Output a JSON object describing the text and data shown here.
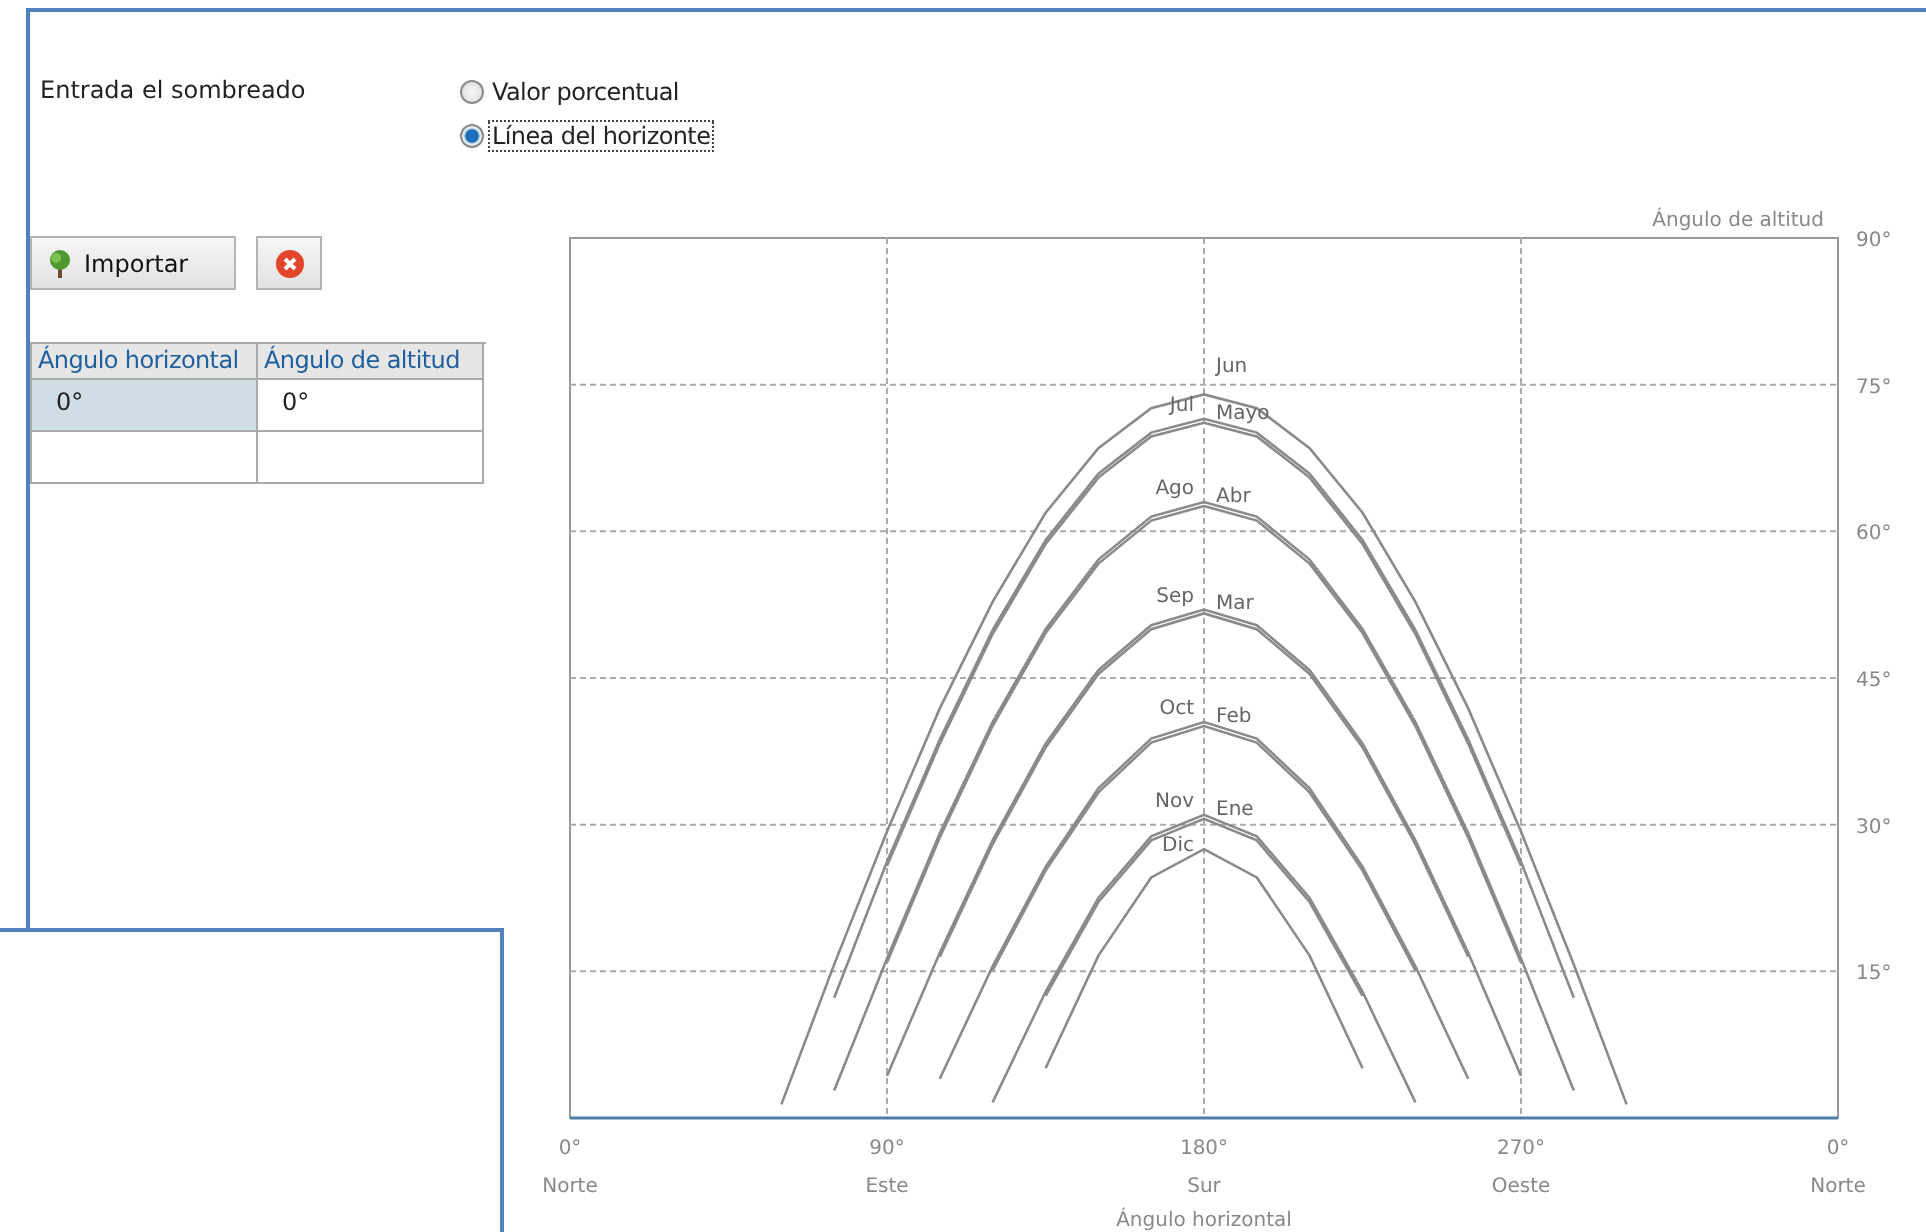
{
  "shading": {
    "label": "Entrada el sombreado",
    "options": [
      {
        "label": "Valor porcentual",
        "selected": false,
        "focused": false
      },
      {
        "label": "Línea del horizonte",
        "selected": true,
        "focused": true
      }
    ]
  },
  "toolbar": {
    "import_label": "Importar"
  },
  "table": {
    "columns": [
      "Ángulo horizontal",
      "Ángulo de altitud"
    ],
    "rows": [
      {
        "cells": [
          "0°",
          "0°"
        ],
        "selected": true
      }
    ]
  },
  "chart": {
    "chart_data": {
      "type": "line",
      "xlabel": "Ángulo horizontal",
      "ylabel": "Ángulo de altitud",
      "grid": true,
      "x": [
        60,
        75,
        90,
        105,
        120,
        135,
        150,
        165,
        180,
        195,
        210,
        225,
        240,
        255,
        270,
        285,
        300
      ],
      "xlim": [
        0,
        360
      ],
      "ylim": [
        0,
        90
      ],
      "xticks": [
        {
          "value": 0,
          "label": "0°"
        },
        {
          "value": 90,
          "label": "90°"
        },
        {
          "value": 180,
          "label": "180°"
        },
        {
          "value": 270,
          "label": "270°"
        }
      ],
      "yticks": [
        {
          "value": 15,
          "label": "15°"
        },
        {
          "value": 30,
          "label": "30°"
        },
        {
          "value": 45,
          "label": "45°"
        },
        {
          "value": 60,
          "label": "60°"
        },
        {
          "value": 75,
          "label": "75°"
        },
        {
          "value": 90,
          "label": "90°"
        }
      ],
      "series": [
        {
          "name": "Jun",
          "color": "#8a8a8a",
          "values": [
            1.4,
            15.7,
            29.3,
            41.9,
            52.8,
            61.9,
            68.5,
            72.6,
            74,
            72.6,
            68.5,
            61.9,
            52.8,
            41.9,
            29.3,
            15.7,
            1.4
          ]
        },
        {
          "name": "Jul",
          "color": "#8a8a8a",
          "values": [
            null,
            12.3,
            26.2,
            38.7,
            49.9,
            59.1,
            65.9,
            70.1,
            71.5,
            70.1,
            65.9,
            59.1,
            49.9,
            38.7,
            26.2,
            12.3,
            null
          ]
        },
        {
          "name": "Mayo",
          "color": "#8a8a8a",
          "values": [
            null,
            null,
            25.8,
            38.3,
            49.5,
            58.7,
            65.5,
            69.7,
            71.1,
            69.7,
            65.5,
            58.7,
            49.5,
            38.3,
            25.8,
            null,
            null
          ]
        },
        {
          "name": "Ago",
          "color": "#8a8a8a",
          "values": [
            null,
            2.8,
            16.3,
            29.1,
            40.5,
            50.0,
            57.1,
            61.5,
            63,
            61.5,
            57.1,
            50.0,
            40.5,
            29.1,
            16.3,
            2.8,
            null
          ]
        },
        {
          "name": "Abr",
          "color": "#8a8a8a",
          "values": [
            null,
            null,
            15.9,
            28.7,
            40.1,
            49.6,
            56.7,
            61.1,
            62.6,
            61.1,
            56.7,
            49.6,
            40.1,
            28.7,
            15.9,
            null,
            null
          ]
        },
        {
          "name": "Sep",
          "color": "#8a8a8a",
          "values": [
            null,
            null,
            4.3,
            16.9,
            28.4,
            38.3,
            45.8,
            50.4,
            52,
            50.4,
            45.8,
            38.3,
            28.4,
            16.9,
            4.3,
            null,
            null
          ]
        },
        {
          "name": "Mar",
          "color": "#8a8a8a",
          "values": [
            null,
            null,
            null,
            16.5,
            28.0,
            37.9,
            45.4,
            50.0,
            51.6,
            50.0,
            45.4,
            37.9,
            28.0,
            16.5,
            null,
            null,
            null
          ]
        },
        {
          "name": "Oct",
          "color": "#8a8a8a",
          "values": [
            null,
            null,
            null,
            4.0,
            15.5,
            25.7,
            33.7,
            38.8,
            40.5,
            38.8,
            33.7,
            25.7,
            15.5,
            4.0,
            null,
            null,
            null
          ]
        },
        {
          "name": "Feb",
          "color": "#8a8a8a",
          "values": [
            null,
            null,
            null,
            null,
            15.1,
            25.3,
            33.3,
            38.4,
            40.1,
            38.4,
            33.3,
            25.3,
            15.1,
            null,
            null,
            null,
            null
          ]
        },
        {
          "name": "Nov",
          "color": "#8a8a8a",
          "values": [
            null,
            null,
            null,
            null,
            1.6,
            12.9,
            22.5,
            28.8,
            31,
            28.8,
            22.5,
            12.9,
            1.6,
            null,
            null,
            null,
            null
          ]
        },
        {
          "name": "Ene",
          "color": "#8a8a8a",
          "values": [
            null,
            null,
            null,
            null,
            null,
            12.5,
            22.1,
            28.4,
            30.6,
            28.4,
            22.1,
            12.5,
            null,
            null,
            null,
            null,
            null
          ]
        },
        {
          "name": "Dic",
          "color": "#8a8a8a",
          "values": [
            null,
            null,
            null,
            null,
            null,
            5.1,
            16.6,
            24.6,
            27.5,
            24.6,
            16.6,
            5.1,
            null,
            null,
            null,
            null,
            null
          ]
        }
      ]
    },
    "wrap_label": "0°",
    "directions": [
      "Norte",
      "Este",
      "Sur",
      "Oeste",
      "Norte"
    ]
  }
}
